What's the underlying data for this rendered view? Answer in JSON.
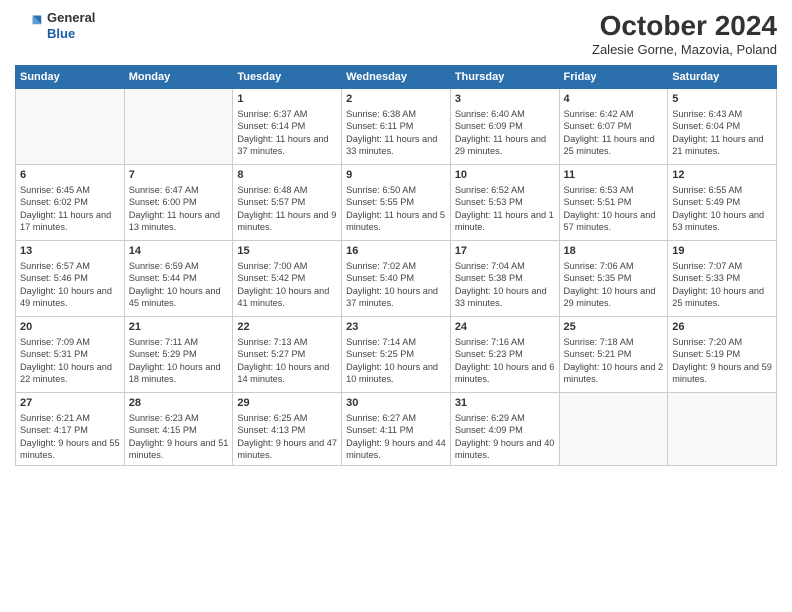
{
  "header": {
    "logo_general": "General",
    "logo_blue": "Blue",
    "month_title": "October 2024",
    "subtitle": "Zalesie Gorne, Mazovia, Poland"
  },
  "weekdays": [
    "Sunday",
    "Monday",
    "Tuesday",
    "Wednesday",
    "Thursday",
    "Friday",
    "Saturday"
  ],
  "weeks": [
    [
      {
        "day": "",
        "info": ""
      },
      {
        "day": "",
        "info": ""
      },
      {
        "day": "1",
        "info": "Sunrise: 6:37 AM\nSunset: 6:14 PM\nDaylight: 11 hours and 37 minutes."
      },
      {
        "day": "2",
        "info": "Sunrise: 6:38 AM\nSunset: 6:11 PM\nDaylight: 11 hours and 33 minutes."
      },
      {
        "day": "3",
        "info": "Sunrise: 6:40 AM\nSunset: 6:09 PM\nDaylight: 11 hours and 29 minutes."
      },
      {
        "day": "4",
        "info": "Sunrise: 6:42 AM\nSunset: 6:07 PM\nDaylight: 11 hours and 25 minutes."
      },
      {
        "day": "5",
        "info": "Sunrise: 6:43 AM\nSunset: 6:04 PM\nDaylight: 11 hours and 21 minutes."
      }
    ],
    [
      {
        "day": "6",
        "info": "Sunrise: 6:45 AM\nSunset: 6:02 PM\nDaylight: 11 hours and 17 minutes."
      },
      {
        "day": "7",
        "info": "Sunrise: 6:47 AM\nSunset: 6:00 PM\nDaylight: 11 hours and 13 minutes."
      },
      {
        "day": "8",
        "info": "Sunrise: 6:48 AM\nSunset: 5:57 PM\nDaylight: 11 hours and 9 minutes."
      },
      {
        "day": "9",
        "info": "Sunrise: 6:50 AM\nSunset: 5:55 PM\nDaylight: 11 hours and 5 minutes."
      },
      {
        "day": "10",
        "info": "Sunrise: 6:52 AM\nSunset: 5:53 PM\nDaylight: 11 hours and 1 minute."
      },
      {
        "day": "11",
        "info": "Sunrise: 6:53 AM\nSunset: 5:51 PM\nDaylight: 10 hours and 57 minutes."
      },
      {
        "day": "12",
        "info": "Sunrise: 6:55 AM\nSunset: 5:49 PM\nDaylight: 10 hours and 53 minutes."
      }
    ],
    [
      {
        "day": "13",
        "info": "Sunrise: 6:57 AM\nSunset: 5:46 PM\nDaylight: 10 hours and 49 minutes."
      },
      {
        "day": "14",
        "info": "Sunrise: 6:59 AM\nSunset: 5:44 PM\nDaylight: 10 hours and 45 minutes."
      },
      {
        "day": "15",
        "info": "Sunrise: 7:00 AM\nSunset: 5:42 PM\nDaylight: 10 hours and 41 minutes."
      },
      {
        "day": "16",
        "info": "Sunrise: 7:02 AM\nSunset: 5:40 PM\nDaylight: 10 hours and 37 minutes."
      },
      {
        "day": "17",
        "info": "Sunrise: 7:04 AM\nSunset: 5:38 PM\nDaylight: 10 hours and 33 minutes."
      },
      {
        "day": "18",
        "info": "Sunrise: 7:06 AM\nSunset: 5:35 PM\nDaylight: 10 hours and 29 minutes."
      },
      {
        "day": "19",
        "info": "Sunrise: 7:07 AM\nSunset: 5:33 PM\nDaylight: 10 hours and 25 minutes."
      }
    ],
    [
      {
        "day": "20",
        "info": "Sunrise: 7:09 AM\nSunset: 5:31 PM\nDaylight: 10 hours and 22 minutes."
      },
      {
        "day": "21",
        "info": "Sunrise: 7:11 AM\nSunset: 5:29 PM\nDaylight: 10 hours and 18 minutes."
      },
      {
        "day": "22",
        "info": "Sunrise: 7:13 AM\nSunset: 5:27 PM\nDaylight: 10 hours and 14 minutes."
      },
      {
        "day": "23",
        "info": "Sunrise: 7:14 AM\nSunset: 5:25 PM\nDaylight: 10 hours and 10 minutes."
      },
      {
        "day": "24",
        "info": "Sunrise: 7:16 AM\nSunset: 5:23 PM\nDaylight: 10 hours and 6 minutes."
      },
      {
        "day": "25",
        "info": "Sunrise: 7:18 AM\nSunset: 5:21 PM\nDaylight: 10 hours and 2 minutes."
      },
      {
        "day": "26",
        "info": "Sunrise: 7:20 AM\nSunset: 5:19 PM\nDaylight: 9 hours and 59 minutes."
      }
    ],
    [
      {
        "day": "27",
        "info": "Sunrise: 6:21 AM\nSunset: 4:17 PM\nDaylight: 9 hours and 55 minutes."
      },
      {
        "day": "28",
        "info": "Sunrise: 6:23 AM\nSunset: 4:15 PM\nDaylight: 9 hours and 51 minutes."
      },
      {
        "day": "29",
        "info": "Sunrise: 6:25 AM\nSunset: 4:13 PM\nDaylight: 9 hours and 47 minutes."
      },
      {
        "day": "30",
        "info": "Sunrise: 6:27 AM\nSunset: 4:11 PM\nDaylight: 9 hours and 44 minutes."
      },
      {
        "day": "31",
        "info": "Sunrise: 6:29 AM\nSunset: 4:09 PM\nDaylight: 9 hours and 40 minutes."
      },
      {
        "day": "",
        "info": ""
      },
      {
        "day": "",
        "info": ""
      }
    ]
  ]
}
